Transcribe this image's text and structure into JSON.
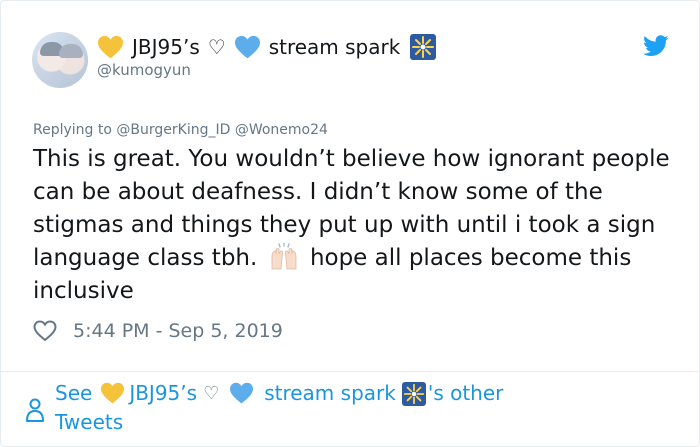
{
  "user": {
    "name_prefix": "JBJ95’s",
    "name_symbol": "♡",
    "name_suffix": "stream spark",
    "handle": "@kumogyun"
  },
  "reply": {
    "prefix": "Replying to",
    "mention1": "@BurgerKing_ID",
    "mention2": "@Wonemo24"
  },
  "tweet": {
    "part1": "This is great. You wouldn’t believe how ignorant people can be about deafness. I didn’t know some of the stigmas and things they put up with until i took a sign language class tbh.",
    "part2": "hope all places become this inclusive"
  },
  "meta": {
    "timestamp": "5:44 PM - Sep 5, 2019"
  },
  "footer": {
    "see": "See",
    "name_prefix": "JBJ95’s",
    "name_symbol": "♡",
    "name_suffix": "stream spark",
    "possessive": "'s other",
    "tweets": "Tweets"
  },
  "colors": {
    "link": "#1b95e0",
    "muted": "#657786",
    "text": "#14171a",
    "yellow_heart": "#f5c33b",
    "blue_heart": "#5dadec",
    "twitter_blue": "#1da1f2"
  }
}
